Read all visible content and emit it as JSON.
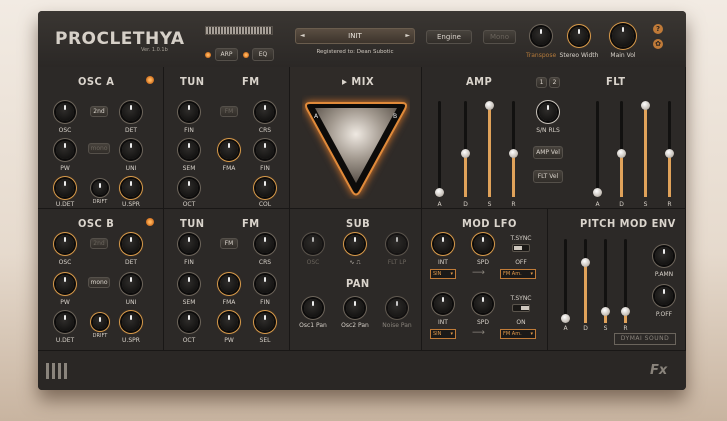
{
  "header": {
    "logo": "PROCLETHYA",
    "version": "Ver. 1.0.1b",
    "arp_label": "ARP",
    "eq_label": "EQ",
    "preset_name": "INIT",
    "preset_prev": "◄",
    "preset_next": "►",
    "registered": "Registered to: Dean Subotic",
    "engine_label": "Engine",
    "mono_label": "Mono",
    "transpose_label": "Transpose",
    "stereo_width_label": "Stereo Width",
    "main_vol_label": "Main Vol",
    "help_label": "?"
  },
  "osc_a": {
    "title": "OSC A",
    "oct_button": "2nd",
    "mono_button": "mono",
    "labels": [
      "OSC",
      "DET",
      "PW",
      "UNI",
      "U.DET",
      "DRIFT",
      "U.SPR"
    ]
  },
  "osc_b": {
    "title": "OSC B",
    "oct_button": "2nd",
    "mono_button": "mono",
    "labels": [
      "OSC",
      "DET",
      "PW",
      "UNI",
      "U.DET",
      "DRIFT",
      "U.SPR"
    ]
  },
  "tun_fm_a": {
    "tun_title": "TUN",
    "fm_title": "FM",
    "fm_button": "FM",
    "labels": [
      "FIN",
      "CRS",
      "SEM",
      "FMA",
      "FIN",
      "OCT",
      "COL"
    ]
  },
  "tun_fm_b": {
    "tun_title": "TUN",
    "fm_title": "FM",
    "fm_button": "FM",
    "labels": [
      "FIN",
      "CRS",
      "SEM",
      "FMA",
      "FIN",
      "OCT",
      "PW",
      "SEL"
    ]
  },
  "mix": {
    "title": "MIX",
    "corner_a": "A",
    "corner_b": "B"
  },
  "sub": {
    "title": "SUB",
    "labels": [
      "OSC",
      "",
      "FLT LP"
    ]
  },
  "pan": {
    "title": "PAN",
    "labels": [
      "Osc1 Pan",
      "Osc2 Pan",
      "Noise Pan"
    ]
  },
  "amp": {
    "title": "AMP",
    "labels": [
      "A",
      "D",
      "S",
      "R"
    ],
    "values": [
      0.0,
      0.45,
      1.0,
      0.45
    ]
  },
  "flt": {
    "title": "FLT",
    "tab1": "1",
    "tab2": "2",
    "labels": [
      "A",
      "D",
      "S",
      "R"
    ],
    "values": [
      0.0,
      0.45,
      1.0,
      0.45
    ],
    "sin_rls_label": "S/N RLS",
    "amp_vel_label": "AMP Vel",
    "flt_vel_label": "FLT Vel"
  },
  "mod_lfo": {
    "title": "MOD LFO",
    "lfo1": {
      "labels": [
        "INT",
        "SPD",
        "T.SYNC",
        "OFF"
      ],
      "shape": "SIN",
      "target": "FM Am."
    },
    "lfo2": {
      "labels": [
        "INT",
        "SPD",
        "T.SYNC",
        "ON"
      ],
      "shape": "SIN",
      "target": "FM Am."
    }
  },
  "pitch_env": {
    "title": "PITCH MOD ENV",
    "labels": [
      "A",
      "D",
      "S",
      "R",
      "P.AMN",
      "P.OFF"
    ],
    "values": [
      0.0,
      0.75,
      0.1,
      0.1
    ]
  },
  "footer": {
    "brand": "DYMAI SOUND",
    "fx_label": "Fx"
  }
}
